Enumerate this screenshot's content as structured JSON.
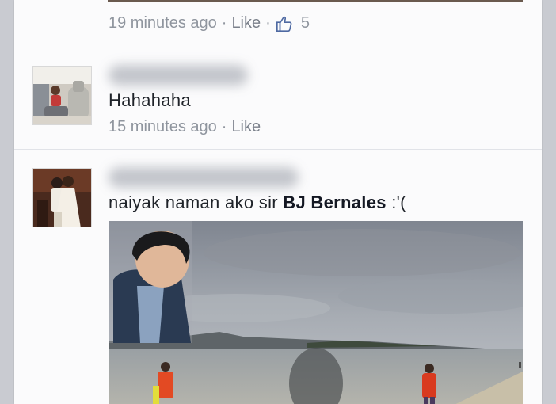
{
  "comments": [
    {
      "timestamp": "19 minutes ago",
      "like_label": "Like",
      "like_count": "5",
      "separator": "·"
    },
    {
      "text": "Hahahaha",
      "timestamp": "15 minutes ago",
      "like_label": "Like",
      "separator": "·"
    },
    {
      "text_prefix": "naiyak naman ako sir ",
      "mention": "BJ Bernales",
      "text_suffix": " :'("
    }
  ],
  "colors": {
    "meta_text": "#8f959e",
    "comment_text": "#1f2329",
    "divider": "#e1e3e8",
    "background": "#c9cbd1"
  }
}
